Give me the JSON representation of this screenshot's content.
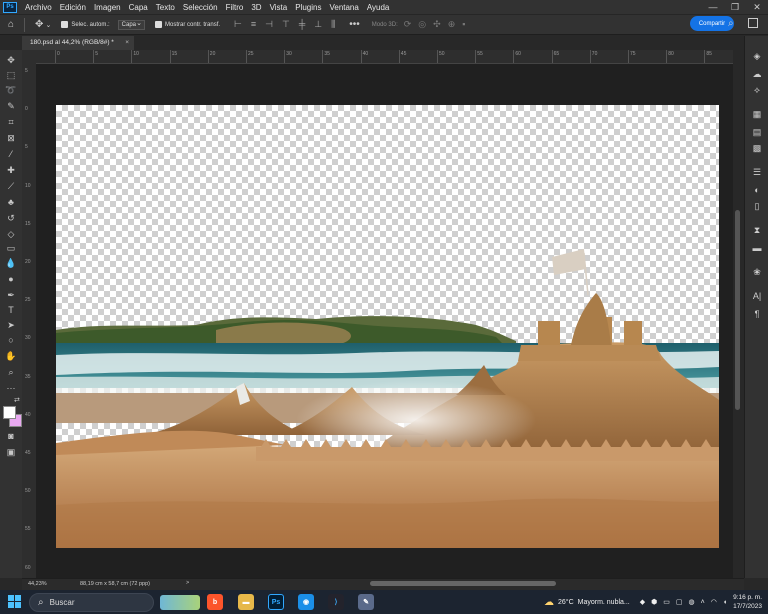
{
  "menu": {
    "logo": "Ps",
    "items": [
      "Archivo",
      "Edición",
      "Imagen",
      "Capa",
      "Texto",
      "Selección",
      "Filtro",
      "3D",
      "Vista",
      "Plugins",
      "Ventana",
      "Ayuda"
    ]
  },
  "window_controls": [
    "—",
    "❐",
    "✕"
  ],
  "options": {
    "auto_select_label": "Selec. autom.:",
    "auto_select_target": "Capa",
    "transform_label": "Mostrar contr. transf.",
    "more": "•••",
    "mode_3d": "Modo 3D:",
    "share_label": "Compartir"
  },
  "document": {
    "tab_title": "180.psd al 44,2% (RGB/8#) *",
    "close": "×"
  },
  "ruler": {
    "h_ticks": [
      "0",
      "5",
      "10",
      "15",
      "20",
      "25",
      "30",
      "35",
      "40",
      "45",
      "50",
      "55",
      "60",
      "65",
      "70",
      "75",
      "80",
      "85"
    ],
    "v_ticks": [
      "5",
      "0",
      "5",
      "10",
      "15",
      "20",
      "25",
      "30",
      "35",
      "40",
      "45",
      "50",
      "55",
      "60"
    ]
  },
  "status": {
    "zoom": "44,23%",
    "dimensions": "88,19 cm x 58,7 cm (72 ppp)",
    "arrow": ">"
  },
  "taskbar": {
    "search_placeholder": "Buscar",
    "weather_temp": "26°C",
    "weather_desc": "Mayorm. nubla...",
    "time": "9:16 p. m.",
    "date": "17/7/2023"
  },
  "colors": {
    "accent": "#1473e6",
    "bg": "#282828",
    "panel": "#323232",
    "foreground_swatch": "#ffffff",
    "background_swatch": "#e8a8f0"
  }
}
